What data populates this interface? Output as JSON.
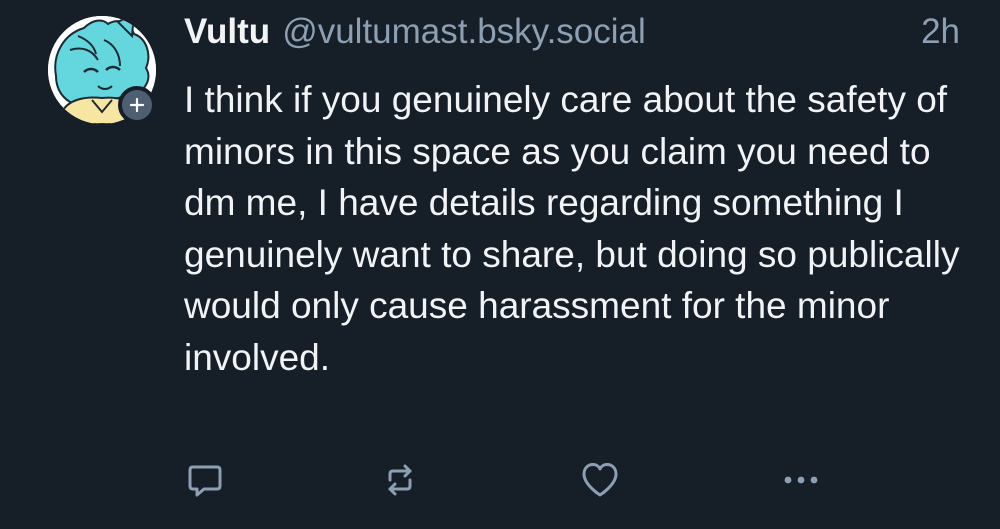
{
  "post": {
    "author": {
      "display_name": "Vultu",
      "handle": "@vultumast.bsky.social"
    },
    "timestamp": "2h",
    "text": "I think if you genuinely care about the safety of minors in this space as you claim you need to dm me, I have details regarding something I genuinely want to share, but doing so publically would only cause harassment for the minor involved."
  },
  "actions": {
    "reply_icon": "speech-bubble-icon",
    "repost_icon": "repost-arrows-icon",
    "like_icon": "heart-icon",
    "more_icon": "ellipsis-icon"
  },
  "colors": {
    "background": "#161e27",
    "text_primary": "#f1f3f5",
    "text_secondary": "#8d9fb3",
    "icon": "#8d9fb3",
    "follow_badge": "#4e5f74"
  }
}
